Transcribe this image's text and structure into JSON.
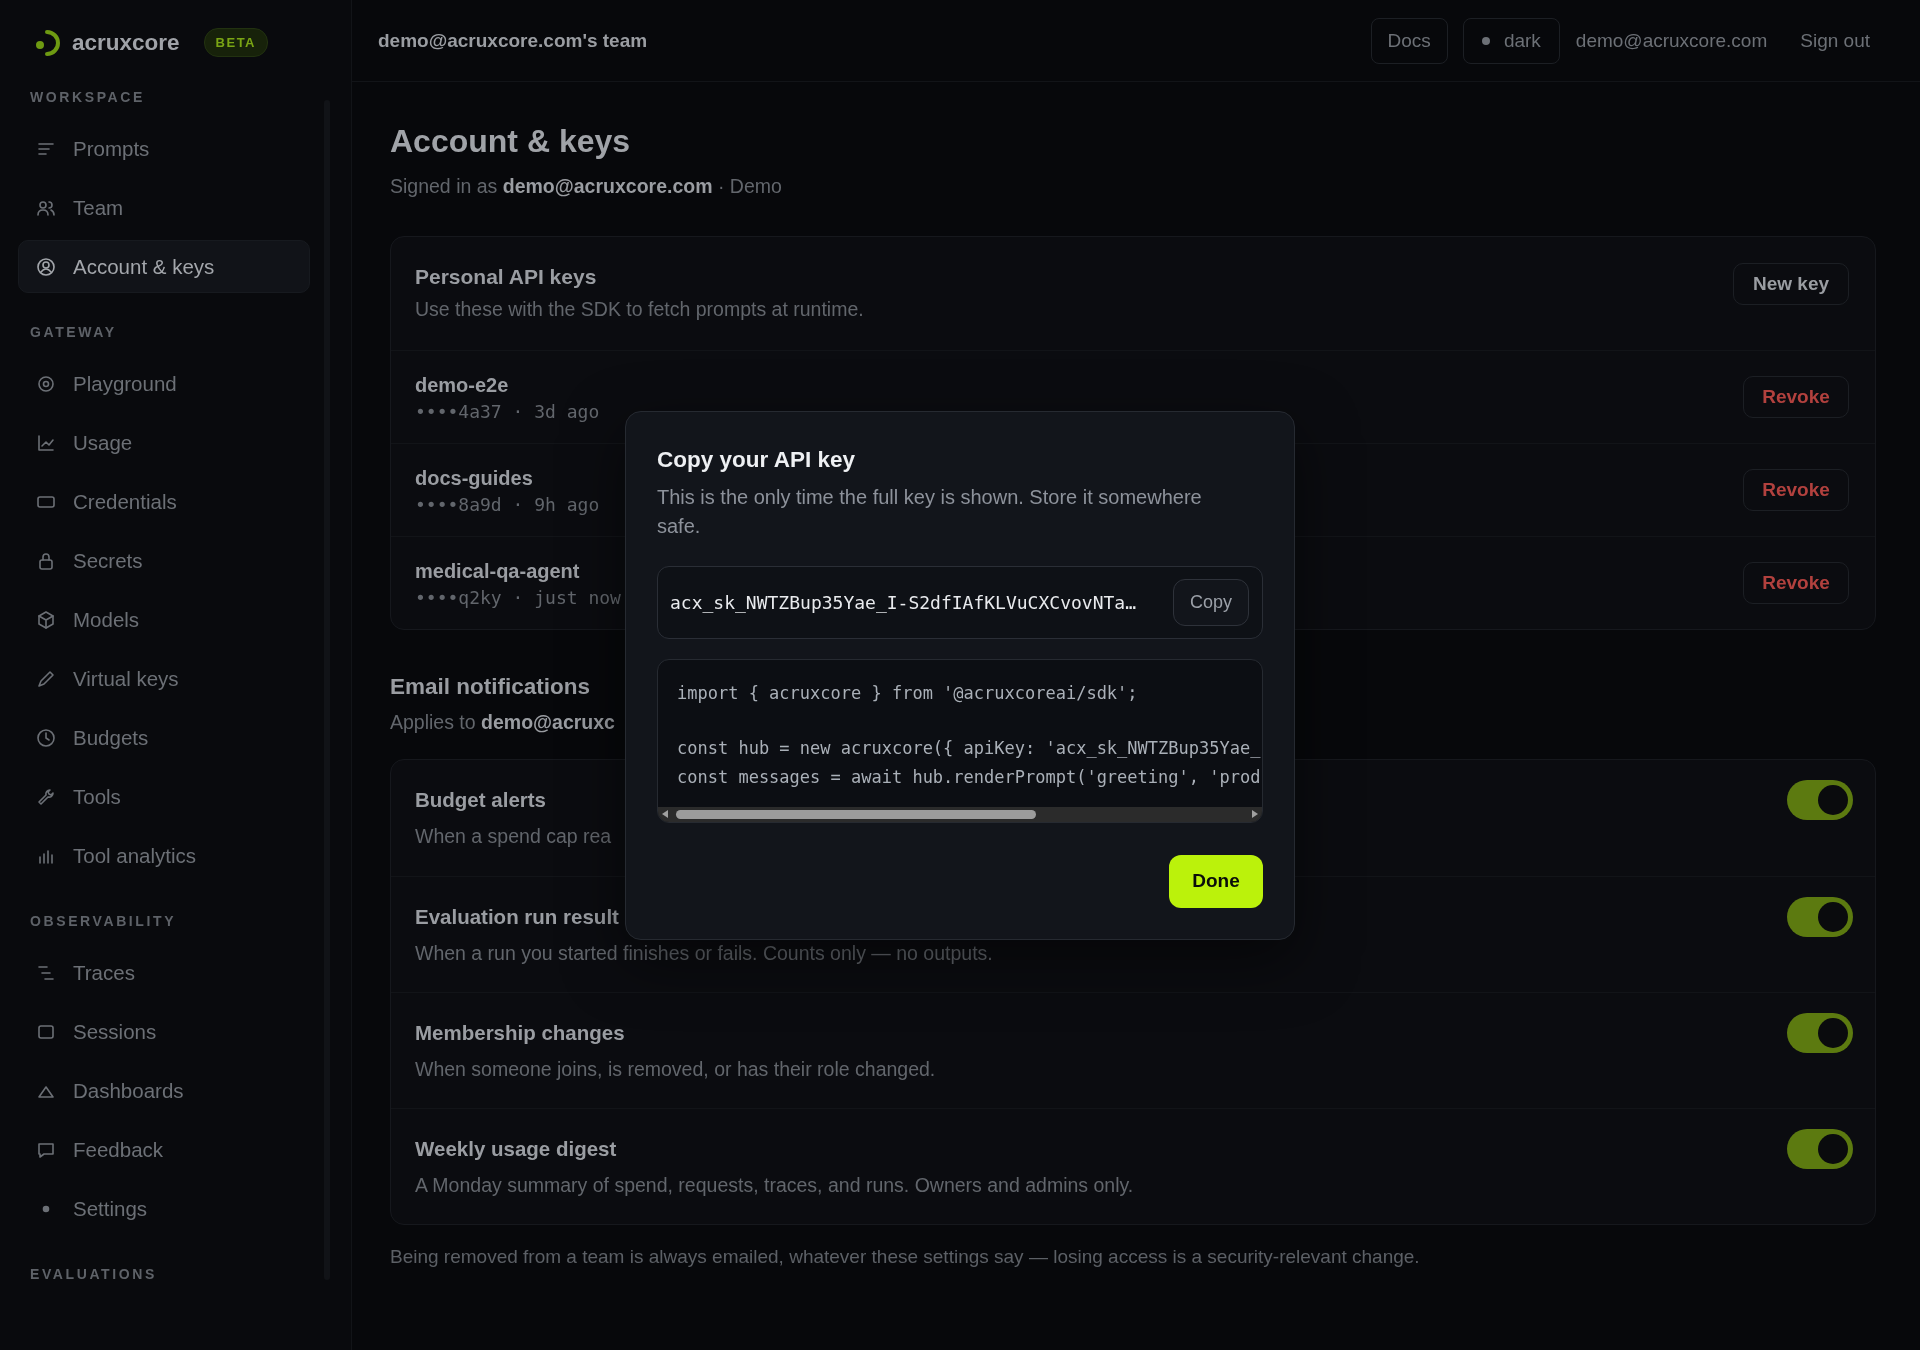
{
  "sidebar": {
    "brand": {
      "name": "acruxcore",
      "badge": "BETA"
    },
    "sections": [
      {
        "label": "WORKSPACE",
        "items": [
          {
            "label": "Prompts",
            "selected": false
          },
          {
            "label": "Team",
            "selected": false
          },
          {
            "label": "Account & keys",
            "selected": true
          }
        ]
      },
      {
        "label": "GATEWAY",
        "items": [
          {
            "label": "Playground",
            "selected": false
          },
          {
            "label": "Usage",
            "selected": false
          },
          {
            "label": "Credentials",
            "selected": false
          },
          {
            "label": "Secrets",
            "selected": false
          },
          {
            "label": "Models",
            "selected": false
          },
          {
            "label": "Virtual keys",
            "selected": false
          },
          {
            "label": "Budgets",
            "selected": false
          },
          {
            "label": "Tools",
            "selected": false
          },
          {
            "label": "Tool analytics",
            "selected": false
          }
        ]
      },
      {
        "label": "OBSERVABILITY",
        "items": [
          {
            "label": "Traces",
            "selected": false
          },
          {
            "label": "Sessions",
            "selected": false
          },
          {
            "label": "Dashboards",
            "selected": false
          },
          {
            "label": "Feedback",
            "selected": false
          },
          {
            "label": "Settings",
            "selected": false
          }
        ]
      },
      {
        "label": "EVALUATIONS"
      }
    ]
  },
  "header": {
    "team": "demo@acruxcore.com's team",
    "docs": "Docs",
    "theme": "dark",
    "email": "demo@acruxcore.com",
    "sign_out": "Sign out"
  },
  "page": {
    "title": "Account & keys",
    "subtitle": "Signed in as **demo@acruxcore.com** · Demo"
  },
  "api_keys": {
    "title": "Personal API keys",
    "description": "Use these with the SDK to fetch prompts at runtime.",
    "new_key": "New key",
    "keys": [
      {
        "name": "demo-e2e",
        "meta": "••••4a37 · 3d ago",
        "revoke": "Revoke"
      },
      {
        "name": "docs-guides",
        "meta": "••••8a9d · 9h ago",
        "revoke": "Revoke"
      },
      {
        "name": "medical-qa-agent",
        "meta": "••••q2ky · just now",
        "revoke": "Revoke"
      }
    ]
  },
  "notifications": {
    "title": "Email notifications",
    "subtitle": "Applies to **demo@acruxc**",
    "items": [
      {
        "title": "Budget alerts",
        "description": "When a spend cap rea",
        "on": true
      },
      {
        "title": "Evaluation run result",
        "description": "When a run you started finishes or fails. Counts only — no outputs.",
        "on": true
      },
      {
        "title": "Membership changes",
        "description": "When someone joins, is removed, or has their role changed.",
        "on": true
      },
      {
        "title": "Weekly usage digest",
        "description": "A Monday summary of spend, requests, traces, and runs. Owners and admins only.",
        "on": true
      }
    ],
    "footnote": "Being removed from a team is always emailed, whatever these settings say — losing access is a security-relevant change."
  },
  "modal": {
    "title": "Copy your API key",
    "description": "This is the only time the full key is shown. Store it somewhere safe.",
    "api_key": "acx_sk_NWTZBup35Yae_I-S2dfIAfKLVuCXCvovNTa…",
    "copy": "Copy",
    "code_blocks": [
      [
        "import { acruxcore } from '@acruxcoreai/sdk';"
      ],
      [
        "const hub = new acruxcore({ apiKey: 'acx_sk_NWTZBup35Yae_",
        "const messages = await hub.renderPrompt('greeting', 'prod"
      ]
    ],
    "done": "Done"
  }
}
